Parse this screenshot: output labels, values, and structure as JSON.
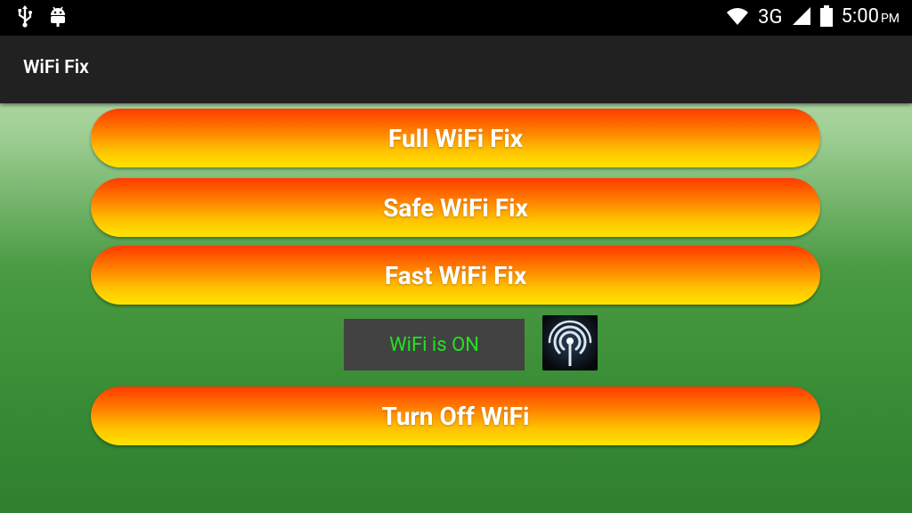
{
  "status_bar": {
    "network_type": "3G",
    "time": "5:00",
    "ampm": "PM",
    "icons": [
      "usb-icon",
      "android-debug-icon",
      "wifi-signal-icon",
      "cell-signal-icon",
      "battery-icon"
    ]
  },
  "app": {
    "title": "WiFi Fix"
  },
  "buttons": {
    "full_fix": "Full WiFi Fix",
    "safe_fix": "Safe WiFi Fix",
    "fast_fix": "Fast WiFi Fix",
    "turn_off": "Turn Off WiFi"
  },
  "wifi_status": {
    "text": "WiFi is ON",
    "icon": "wifi-tower-icon"
  },
  "colors": {
    "status_text": "#22e322",
    "button_top": "#ff3a00",
    "button_bottom": "#ffe500",
    "action_bar": "#212121"
  }
}
